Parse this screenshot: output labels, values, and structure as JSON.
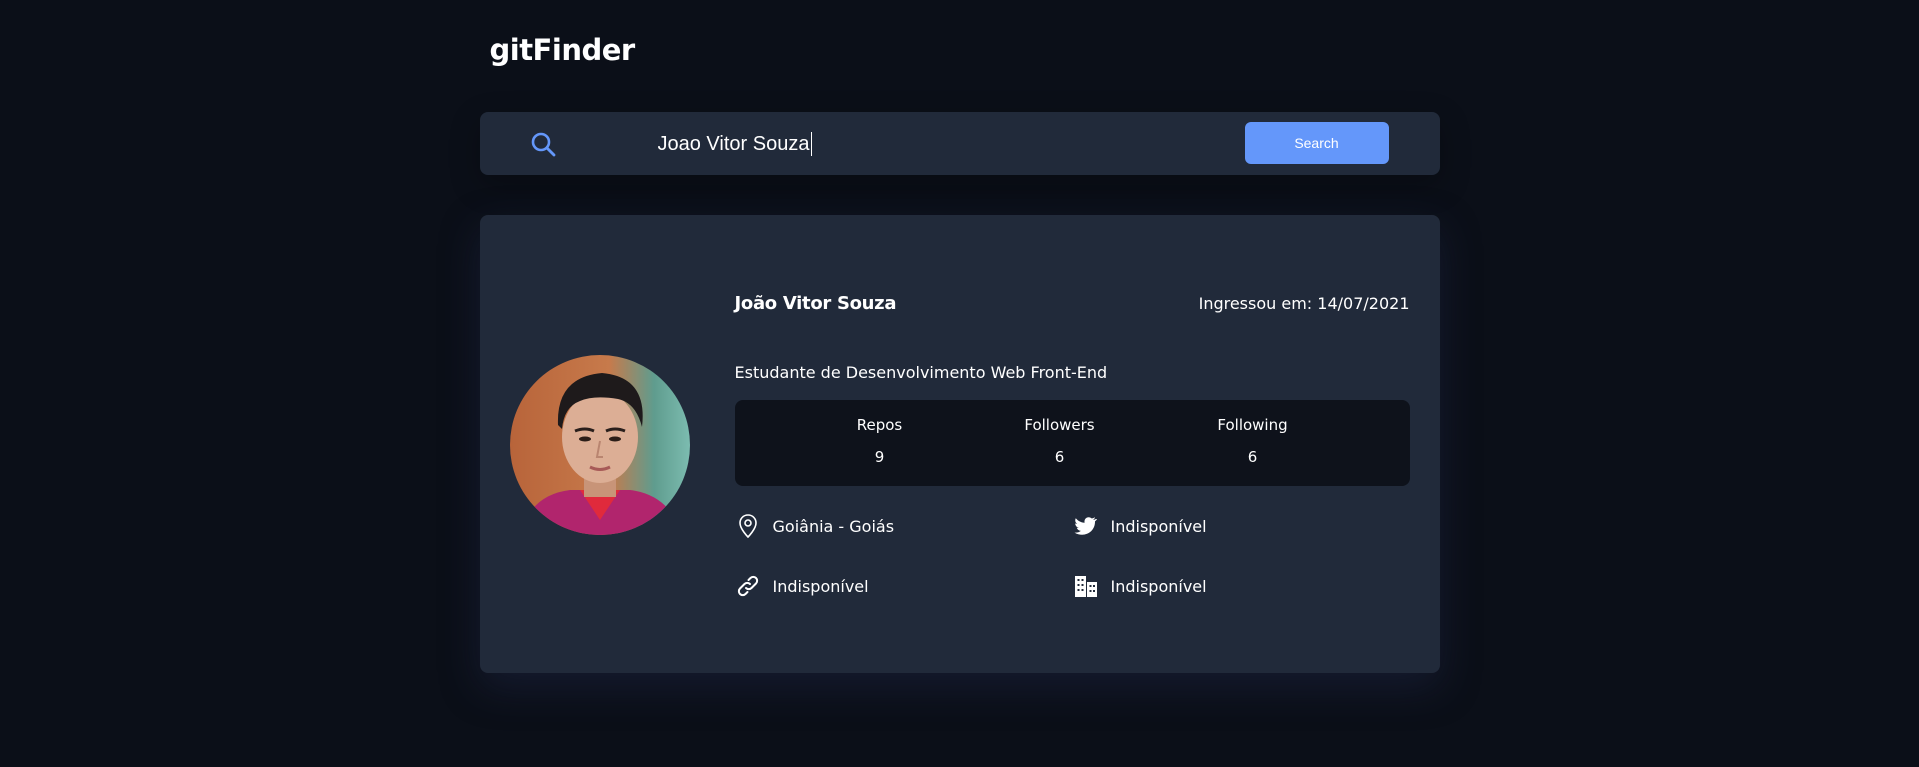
{
  "header": {
    "logo": "gitFinder"
  },
  "search": {
    "value": "Joao Vitor Souza",
    "placeholder": "",
    "button_label": "Search"
  },
  "profile": {
    "name": "João Vitor Souza",
    "joined": "Ingressou em: 14/07/2021",
    "bio": "Estudante de Desenvolvimento Web Front-End",
    "stats": {
      "repos_label": "Repos",
      "repos_value": "9",
      "followers_label": "Followers",
      "followers_value": "6",
      "following_label": "Following",
      "following_value": "6"
    },
    "location": "Goiânia - Goiás",
    "twitter": "Indisponível",
    "blog": "Indisponível",
    "company": "Indisponível"
  },
  "colors": {
    "background": "#0b0f18",
    "card": "#212a3a",
    "stats_panel": "#0e121b",
    "accent": "#6497fa"
  },
  "icons": {
    "search": "search-icon",
    "location": "map-pin-icon",
    "twitter": "twitter-icon",
    "blog": "link-icon",
    "company": "building-icon"
  }
}
